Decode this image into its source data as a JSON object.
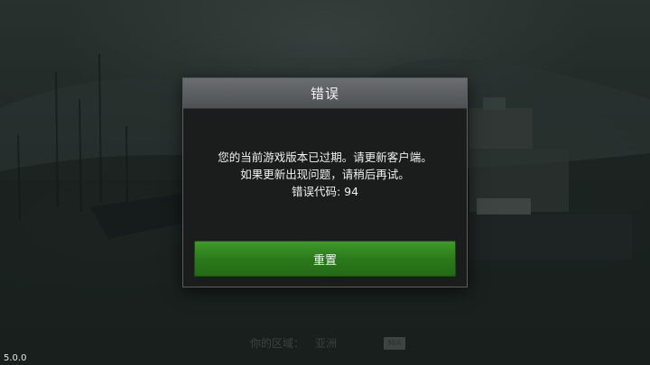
{
  "dialog": {
    "title": "错误",
    "message_lines": [
      "您的当前游戏版本已过期。请更新客户端。",
      "如果更新出现问题，请稍后再试。",
      "错误代码: 94"
    ],
    "reset_label": "重置"
  },
  "footer": {
    "region_label": "你的区域：",
    "region_value": "亚洲",
    "region_badge": "MIA"
  },
  "version": "5.0.0",
  "colors": {
    "accent_green": "#2c7a1c",
    "dialog_bg": "#1b1c1c",
    "header_bg": "#5b5f61"
  }
}
